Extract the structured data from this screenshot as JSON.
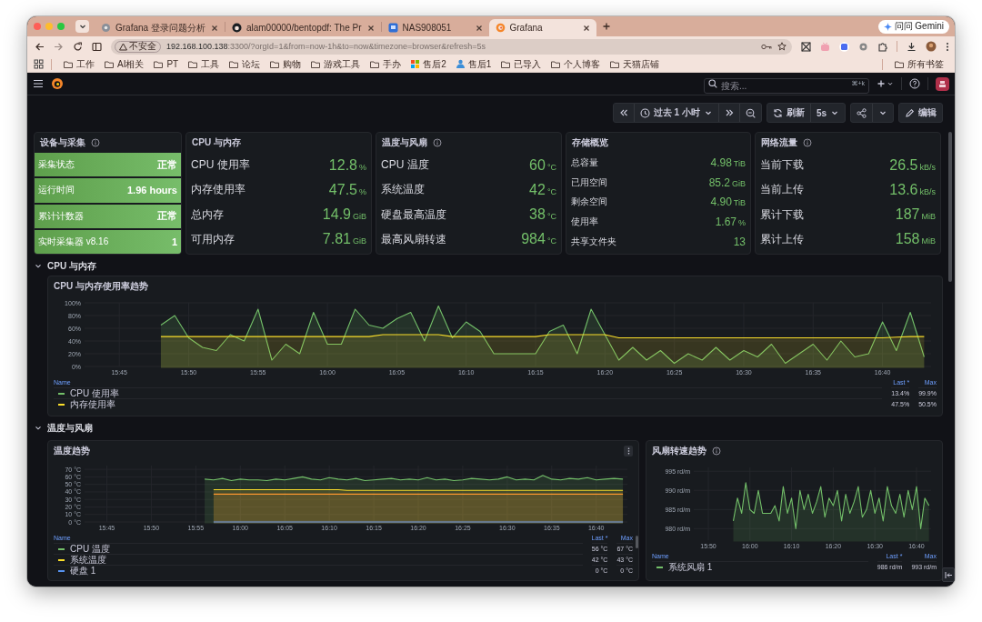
{
  "browser": {
    "tabs": [
      {
        "title": "Grafana 登录问题分析",
        "selected": false
      },
      {
        "title": "alam00000/bentopdf: The Pr",
        "selected": false
      },
      {
        "title": "NAS908051",
        "selected": false
      },
      {
        "title": "Grafana",
        "selected": true
      }
    ],
    "gemini_button": "问问 Gemini",
    "address": {
      "security_badge": "不安全",
      "host": "192.168.100.138",
      "path": ":3300/?orgId=1&from=now-1h&to=now&timezone=browser&refresh=5s"
    },
    "bookmarks": [
      {
        "label": "工作",
        "kind": "folder"
      },
      {
        "label": "AI相关",
        "kind": "folder"
      },
      {
        "label": "PT",
        "kind": "folder"
      },
      {
        "label": "工具",
        "kind": "folder"
      },
      {
        "label": "论坛",
        "kind": "folder"
      },
      {
        "label": "购物",
        "kind": "folder"
      },
      {
        "label": "游戏工具",
        "kind": "folder"
      },
      {
        "label": "手办",
        "kind": "folder"
      },
      {
        "label": "售后2",
        "kind": "site"
      },
      {
        "label": "售后1",
        "kind": "site"
      },
      {
        "label": "已导入",
        "kind": "folder"
      },
      {
        "label": "个人博客",
        "kind": "folder"
      },
      {
        "label": "天猫店铺",
        "kind": "folder"
      }
    ],
    "all_bookmarks": "所有书签"
  },
  "grafana": {
    "search": {
      "placeholder": "搜索...",
      "shortcut": "⌘+k"
    },
    "time_range": "过去 1 小时",
    "refresh_button": "刷新",
    "refresh_interval": "5s",
    "edit_button": "编辑",
    "stat_panels": [
      {
        "title": "设备与采集",
        "info": true,
        "kind": "status",
        "items": [
          {
            "label": "采集状态",
            "value": "正常"
          },
          {
            "label": "运行时间",
            "value": "1.96 hours"
          },
          {
            "label": "累计计数器",
            "value": "正常"
          },
          {
            "label": "实时采集器 v8.16",
            "value": "1"
          }
        ]
      },
      {
        "title": "CPU 与内存",
        "kind": "large",
        "items": [
          {
            "label": "CPU 使用率",
            "value": "12.8",
            "unit": "%"
          },
          {
            "label": "内存使用率",
            "value": "47.5",
            "unit": "%"
          },
          {
            "label": "总内存",
            "value": "14.9",
            "unit": "GiB"
          },
          {
            "label": "可用内存",
            "value": "7.81",
            "unit": "GiB"
          }
        ]
      },
      {
        "title": "温度与风扇",
        "info": true,
        "kind": "large",
        "items": [
          {
            "label": "CPU 温度",
            "value": "60",
            "unit": "°C"
          },
          {
            "label": "系统温度",
            "value": "42",
            "unit": "°C"
          },
          {
            "label": "硬盘最高温度",
            "value": "38",
            "unit": "°C"
          },
          {
            "label": "最高风扇转速",
            "value": "984",
            "unit": "°C"
          }
        ]
      },
      {
        "title": "存储概览",
        "kind": "small",
        "items": [
          {
            "label": "总容量",
            "value": "4.98",
            "unit": "TiB"
          },
          {
            "label": "已用空间",
            "value": "85.2",
            "unit": "GiB"
          },
          {
            "label": "剩余空间",
            "value": "4.90",
            "unit": "TiB"
          },
          {
            "label": "使用率",
            "value": "1.67",
            "unit": "%"
          },
          {
            "label": "共享文件夹",
            "value": "13"
          }
        ]
      },
      {
        "title": "网络流量",
        "info": true,
        "kind": "large",
        "items": [
          {
            "label": "当前下载",
            "value": "26.5",
            "unit": "kB/s"
          },
          {
            "label": "当前上传",
            "value": "13.6",
            "unit": "kB/s"
          },
          {
            "label": "累计下载",
            "value": "187",
            "unit": "MiB"
          },
          {
            "label": "累计上传",
            "value": "158",
            "unit": "MiB"
          }
        ]
      }
    ],
    "rows": [
      {
        "title": "CPU 与内存",
        "expanded": true,
        "panels": [
          {
            "chart_data": {
              "type": "area",
              "grid": true,
              "title": "CPU 与内存使用率趋势",
              "ylim": [
                0,
                100
              ],
              "categories": [
                null,
                null,
                "15:45",
                null,
                null,
                null,
                null,
                "15:50",
                null,
                null,
                null,
                null,
                "15:55",
                null,
                null,
                null,
                null,
                "16:00",
                null,
                null,
                null,
                null,
                "16:05",
                null,
                null,
                null,
                null,
                "16:10",
                null,
                null,
                null,
                null,
                "16:15",
                null,
                null,
                null,
                null,
                "16:20",
                null,
                null,
                null,
                null,
                "16:25",
                null,
                null,
                null,
                null,
                "16:30",
                null,
                null,
                null,
                null,
                "16:35",
                null,
                null,
                null,
                null,
                "16:40",
                null,
                null,
                null
              ],
              "yticks": [
                {
                  "value": 0,
                  "label": "0%"
                },
                {
                  "value": 20,
                  "label": "20%"
                },
                {
                  "value": 40,
                  "label": "40%"
                },
                {
                  "value": 60,
                  "label": "60%"
                },
                {
                  "value": 80,
                  "label": "80%"
                },
                {
                  "value": 100,
                  "label": "100%"
                }
              ],
              "series": [
                {
                  "name": "CPU 使用率",
                  "color": "#73bf69",
                  "values": [
                    null,
                    null,
                    null,
                    null,
                    null,
                    65,
                    80,
                    45,
                    30,
                    25,
                    50,
                    40,
                    90,
                    10,
                    35,
                    20,
                    85,
                    35,
                    35,
                    90,
                    65,
                    60,
                    75,
                    85,
                    40,
                    95,
                    45,
                    70,
                    55,
                    20,
                    20,
                    20,
                    20,
                    55,
                    65,
                    20,
                    90,
                    50,
                    10,
                    30,
                    10,
                    25,
                    5,
                    20,
                    10,
                    30,
                    10,
                    25,
                    15,
                    35,
                    5,
                    20,
                    35,
                    10,
                    40,
                    15,
                    20,
                    70,
                    25,
                    85,
                    15
                  ]
                },
                {
                  "name": "内存使用率",
                  "color": "#fade2a",
                  "values": [
                    null,
                    null,
                    null,
                    null,
                    null,
                    47,
                    47,
                    47,
                    47,
                    47,
                    47,
                    47,
                    47,
                    47,
                    47,
                    47,
                    47,
                    47,
                    47,
                    47,
                    47,
                    50,
                    50,
                    50,
                    50,
                    50,
                    47,
                    47,
                    47,
                    47,
                    47,
                    47,
                    47,
                    50,
                    50,
                    50,
                    50,
                    50,
                    45,
                    45,
                    45,
                    45,
                    45,
                    45,
                    45,
                    45,
                    45,
                    45,
                    45,
                    45,
                    45,
                    45,
                    45,
                    45,
                    45,
                    45,
                    45,
                    45,
                    46,
                    47,
                    47
                  ]
                }
              ]
            },
            "legend": {
              "columns": [
                "Name",
                "Last *",
                "Max"
              ],
              "rows": [
                {
                  "last": "13.4%",
                  "max": "99.9%"
                },
                {
                  "last": "47.5%",
                  "max": "50.5%"
                }
              ]
            }
          }
        ]
      },
      {
        "title": "温度与风扇",
        "expanded": true,
        "panels": [
          {
            "menu": true,
            "chart_data": {
              "type": "area",
              "grid": true,
              "title": "温度趋势",
              "ylim": [
                0,
                75
              ],
              "categories": [
                null,
                null,
                "15:45",
                null,
                null,
                null,
                null,
                "15:50",
                null,
                null,
                null,
                null,
                "15:55",
                null,
                null,
                null,
                null,
                "16:00",
                null,
                null,
                null,
                null,
                "16:05",
                null,
                null,
                null,
                null,
                "16:10",
                null,
                null,
                null,
                null,
                "16:15",
                null,
                null,
                null,
                null,
                "16:20",
                null,
                null,
                null,
                null,
                "16:25",
                null,
                null,
                null,
                null,
                "16:30",
                null,
                null,
                null,
                null,
                "16:35",
                null,
                null,
                null,
                null,
                "16:40",
                null,
                null,
                null
              ],
              "yticks": [
                {
                  "value": 0,
                  "label": "0 °C"
                },
                {
                  "value": 10,
                  "label": "10 °C"
                },
                {
                  "value": 20,
                  "label": "20 °C"
                },
                {
                  "value": 30,
                  "label": "30 °C"
                },
                {
                  "value": 40,
                  "label": "40 °C"
                },
                {
                  "value": 50,
                  "label": "50 °C"
                },
                {
                  "value": 60,
                  "label": "60 °C"
                },
                {
                  "value": 70,
                  "label": "70 °C"
                }
              ],
              "series": [
                {
                  "name": "CPU 温度",
                  "color": "#73bf69",
                  "values": [
                    null,
                    null,
                    null,
                    null,
                    null,
                    null,
                    null,
                    null,
                    null,
                    null,
                    null,
                    null,
                    null,
                    57,
                    56,
                    58,
                    55,
                    57,
                    56,
                    56,
                    55,
                    57,
                    56,
                    58,
                    60,
                    57,
                    56,
                    59,
                    57,
                    56,
                    58,
                    55,
                    56,
                    57,
                    58,
                    56,
                    57,
                    56,
                    59,
                    56,
                    57,
                    55,
                    56,
                    58,
                    57,
                    56,
                    57,
                    60,
                    56,
                    57,
                    56,
                    62,
                    57,
                    56,
                    58,
                    57,
                    59,
                    56,
                    57,
                    58,
                    57
                  ]
                },
                {
                  "name": "系统温度",
                  "color": "#fade2a",
                  "values": [
                    null,
                    null,
                    null,
                    null,
                    null,
                    null,
                    null,
                    null,
                    null,
                    null,
                    null,
                    null,
                    null,
                    null,
                    43,
                    43,
                    43,
                    43,
                    43,
                    43,
                    43,
                    43,
                    43,
                    43,
                    43,
                    43,
                    43,
                    43,
                    43,
                    42,
                    42,
                    42,
                    42,
                    42,
                    42,
                    42,
                    42,
                    42,
                    42,
                    42,
                    42,
                    42,
                    42,
                    42,
                    42,
                    42,
                    42,
                    42,
                    42,
                    42,
                    42,
                    42,
                    42,
                    42,
                    42,
                    42,
                    42,
                    42,
                    42,
                    42,
                    42
                  ]
                },
                {
                  "name": "硬盘 1",
                  "color": "#5794f2",
                  "values": [
                    null,
                    null,
                    null,
                    null,
                    null,
                    null,
                    null,
                    null,
                    null,
                    null,
                    null,
                    null,
                    null,
                    null,
                    0,
                    0,
                    0,
                    0,
                    0,
                    0,
                    0,
                    0,
                    0,
                    0,
                    0,
                    0,
                    0,
                    0,
                    0,
                    0,
                    0,
                    0,
                    0,
                    0,
                    0,
                    0,
                    0,
                    0,
                    0,
                    0,
                    0,
                    0,
                    0,
                    0,
                    0,
                    0,
                    0,
                    0,
                    0,
                    0,
                    0,
                    0,
                    0,
                    0,
                    0,
                    0,
                    0,
                    0,
                    0,
                    0,
                    0
                  ]
                },
                {
                  "color": "#ff9830",
                  "values": [
                    null,
                    null,
                    null,
                    null,
                    null,
                    null,
                    null,
                    null,
                    null,
                    null,
                    null,
                    null,
                    null,
                    null,
                    37,
                    37,
                    37,
                    37,
                    37,
                    37,
                    37,
                    37,
                    37,
                    37,
                    37,
                    37,
                    37,
                    37,
                    37,
                    37,
                    37,
                    37,
                    37,
                    37,
                    37,
                    37,
                    37,
                    37,
                    37,
                    37,
                    37,
                    37,
                    37,
                    37,
                    37,
                    37,
                    37,
                    37,
                    37,
                    37,
                    37,
                    37,
                    37,
                    37,
                    37,
                    37,
                    37,
                    37,
                    37,
                    37,
                    37
                  ]
                }
              ]
            },
            "legend": {
              "columns": [
                "Name",
                "Last *",
                "Max"
              ],
              "rows": [
                {
                  "last": "56 °C",
                  "max": "67 °C"
                },
                {
                  "last": "42 °C",
                  "max": "43 °C"
                },
                {
                  "last": "0 °C",
                  "max": "0 °C"
                }
              ]
            }
          },
          {
            "info": true,
            "chart_data": {
              "type": "area",
              "grid": true,
              "title": "风扇转速趋势",
              "ylim": [
                977,
                996
              ],
              "categories": [
                null,
                null,
                null,
                "15:50",
                null,
                null,
                null,
                null,
                null,
                null,
                null,
                null,
                null,
                "16:00",
                null,
                null,
                null,
                null,
                null,
                null,
                null,
                null,
                null,
                "16:10",
                null,
                null,
                null,
                null,
                null,
                null,
                null,
                null,
                null,
                "16:20",
                null,
                null,
                null,
                null,
                null,
                null,
                null,
                null,
                null,
                "16:30",
                null,
                null,
                null,
                null,
                null,
                null,
                null,
                null,
                null,
                "16:40",
                null,
                null,
                null
              ],
              "yticks": [
                {
                  "value": 980,
                  "label": "980 rd/m"
                },
                {
                  "value": 985,
                  "label": "985 rd/m"
                },
                {
                  "value": 990,
                  "label": "990 rd/m"
                },
                {
                  "value": 995,
                  "label": "995 rd/m"
                }
              ],
              "series": [
                {
                  "name": "系统风扇 1",
                  "color": "#73bf69",
                  "values": [
                    null,
                    null,
                    null,
                    null,
                    null,
                    null,
                    null,
                    null,
                    null,
                    982,
                    988,
                    984,
                    992,
                    985,
                    984,
                    990,
                    984,
                    984,
                    984,
                    986,
                    982,
                    991,
                    984,
                    988,
                    980,
                    990,
                    985,
                    989,
                    984,
                    987,
                    991,
                    983,
                    988,
                    986,
                    990,
                    982,
                    989,
                    984,
                    987,
                    991,
                    983,
                    985,
                    990,
                    984,
                    988,
                    982,
                    991,
                    986,
                    984,
                    989,
                    983,
                    990,
                    985,
                    991,
                    980,
                    988,
                    986
                  ]
                }
              ]
            },
            "legend": {
              "columns": [
                "Name",
                "Last *",
                "Max"
              ],
              "rows": [
                {
                  "last": "986 rd/m",
                  "max": "993 rd/m"
                }
              ]
            }
          }
        ]
      }
    ]
  }
}
